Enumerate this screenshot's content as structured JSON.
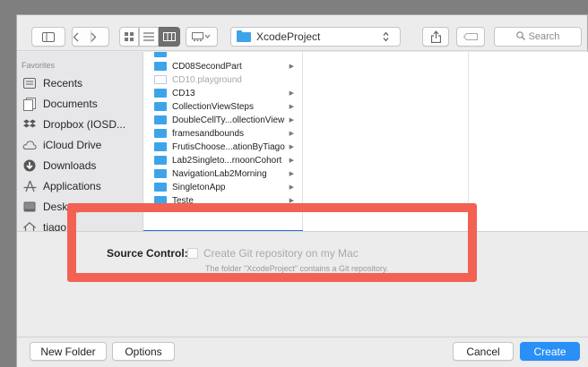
{
  "toolbar": {
    "path_label": "XcodeProject",
    "search_placeholder": "Search",
    "icons": [
      "sidebar-toggle-icon",
      "back-icon",
      "forward-icon",
      "icon-view-icon",
      "list-view-icon",
      "column-view-icon",
      "gallery-view-icon",
      "share-icon",
      "tag-icon",
      "search-icon"
    ]
  },
  "sidebar": {
    "section_title": "Favorites",
    "items": [
      {
        "label": "Recents",
        "icon": "recents-icon"
      },
      {
        "label": "Documents",
        "icon": "documents-icon"
      },
      {
        "label": "Dropbox (IOSD...",
        "icon": "dropbox-icon"
      },
      {
        "label": "iCloud Drive",
        "icon": "cloud-icon"
      },
      {
        "label": "Downloads",
        "icon": "downloads-icon"
      },
      {
        "label": "Applications",
        "icon": "applications-icon"
      },
      {
        "label": "Desktop",
        "icon": "desktop-icon"
      },
      {
        "label": "tiago",
        "icon": "home-icon"
      }
    ]
  },
  "browser": {
    "column1": [
      {
        "name": "CD08SecondPart",
        "kind": "folder",
        "has_children": true
      },
      {
        "name": "CD10.playground",
        "kind": "file",
        "has_children": false
      },
      {
        "name": "CD13",
        "kind": "folder",
        "has_children": true
      },
      {
        "name": "CollectionViewSteps",
        "kind": "folder",
        "has_children": true
      },
      {
        "name": "DoubleCellTy...ollectionView",
        "kind": "folder",
        "has_children": true
      },
      {
        "name": "framesandbounds",
        "kind": "folder",
        "has_children": true
      },
      {
        "name": "FrutisChoose...ationByTiago",
        "kind": "folder",
        "has_children": true
      },
      {
        "name": "Lab2Singleto...rnoonCohort",
        "kind": "folder",
        "has_children": true
      },
      {
        "name": "NavigationLab2Morning",
        "kind": "folder",
        "has_children": true
      },
      {
        "name": "SingletonApp",
        "kind": "folder",
        "has_children": true
      },
      {
        "name": "Teste",
        "kind": "folder",
        "has_children": true
      }
    ]
  },
  "source_control": {
    "label": "Source Control:",
    "checkbox_label": "Create Git repository on my Mac",
    "checked": false,
    "note": "The folder \"XcodeProject\" contains a Git repository."
  },
  "buttons": {
    "new_folder": "New Folder",
    "options": "Options",
    "cancel": "Cancel",
    "create": "Create"
  },
  "colors": {
    "accent": "#2a8ff7",
    "folder": "#3ea4ea",
    "highlight": "#f26152"
  }
}
